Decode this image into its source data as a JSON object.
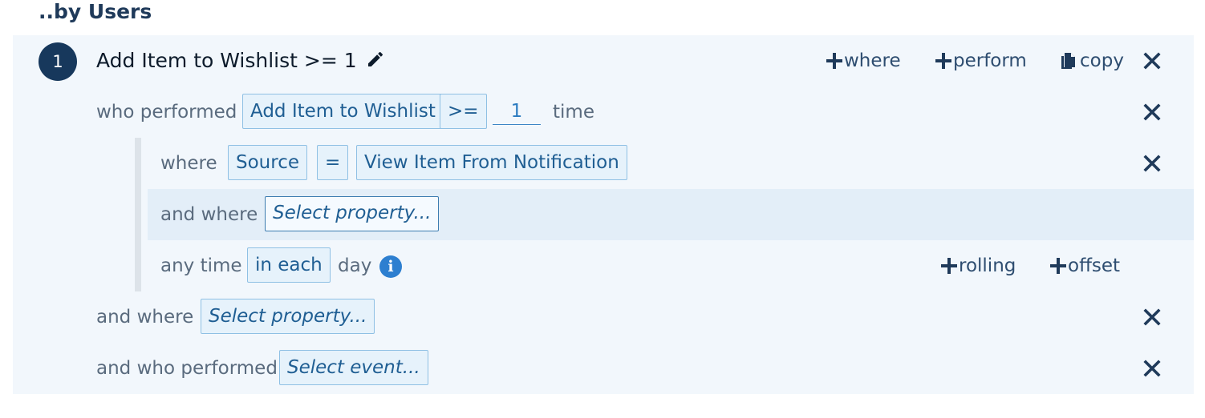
{
  "heading": "..by Users",
  "step": {
    "number": "1",
    "title": "Add Item to Wishlist >= 1",
    "actions": {
      "where": "where",
      "perform": "perform",
      "copy": "copy"
    }
  },
  "performed_row": {
    "label": "who performed",
    "event": "Add Item to Wishlist",
    "operator": ">=",
    "count": "1",
    "unit": "time"
  },
  "where_row": {
    "label": "where",
    "property": "Source",
    "operator": "=",
    "value": "View Item From Notification"
  },
  "and_where_inner": {
    "label": "and where",
    "placeholder": "Select property..."
  },
  "time_row": {
    "label": "any time",
    "mode": "in each",
    "unit": "day",
    "info_icon": "i",
    "rolling": "rolling",
    "offset": "offset"
  },
  "and_where_outer": {
    "label": "and where",
    "placeholder": "Select property..."
  },
  "and_performed": {
    "label": "and who performed",
    "placeholder": "Select event..."
  },
  "colors": {
    "badge": "#17385c",
    "chip_border": "#8fc0e4",
    "chip_bg": "#e6f2fb",
    "info": "#2d7fd0",
    "panel": "#f2f7fc"
  }
}
